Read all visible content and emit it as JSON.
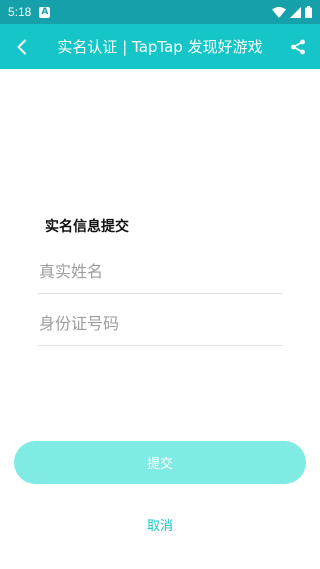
{
  "status_bar": {
    "time": "5:18",
    "notification_icon_label": "A",
    "icons": [
      "a-icon",
      "wifi-icon",
      "signal-icon",
      "battery-icon"
    ]
  },
  "app_bar": {
    "title": "实名认证 | TapTap 发现好游戏",
    "back_icon": "back-arrow-icon",
    "share_icon": "share-icon",
    "background_color": "#15c5c7"
  },
  "form": {
    "title": "实名信息提交",
    "name_field": {
      "placeholder": "真实姓名",
      "value": ""
    },
    "id_field": {
      "placeholder": "身份证号码",
      "value": ""
    },
    "submit_label": "提交",
    "cancel_label": "取消"
  },
  "colors": {
    "accent": "#15c5c7",
    "status_bar": "#15a0aa",
    "submit_button_disabled": "#80ebe3"
  }
}
